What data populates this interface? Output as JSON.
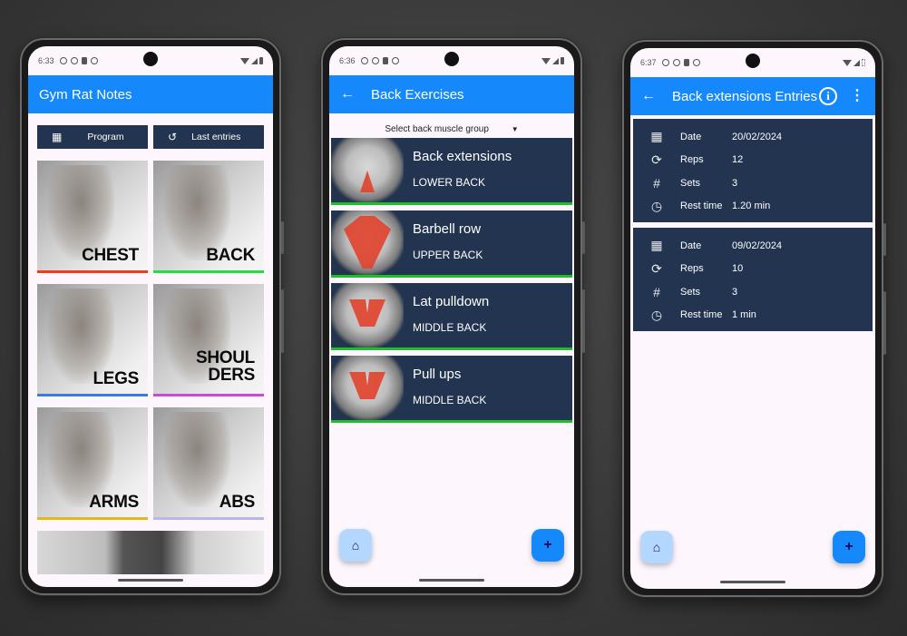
{
  "phones": [
    {
      "status": {
        "time": "6:33"
      },
      "appbar": {
        "title": "Gym Rat Notes"
      },
      "buttons": [
        {
          "label": "Program",
          "icon": "calendar-icon",
          "glyph": "▦"
        },
        {
          "label": "Last entries",
          "icon": "history-icon",
          "glyph": "↺"
        }
      ],
      "tiles": [
        {
          "label": "CHEST",
          "color": "#f33b16"
        },
        {
          "label": "BACK",
          "color": "#22e03a"
        },
        {
          "label": "LEGS",
          "color": "#3d7ae0"
        },
        {
          "label": "SHOUL\nDERS",
          "color": "#c84ad8"
        },
        {
          "label": "ARMS",
          "color": "#e8b61a"
        },
        {
          "label": "ABS",
          "color": "#b9b7ea"
        }
      ]
    },
    {
      "status": {
        "time": "6:36"
      },
      "appbar": {
        "back": "←",
        "title": "Back Exercises"
      },
      "dropdown": {
        "label": "Select back muscle group",
        "caret": "▼"
      },
      "exercises": [
        {
          "name": "Back extensions",
          "group": "LOWER BACK"
        },
        {
          "name": "Barbell row",
          "group": "UPPER BACK"
        },
        {
          "name": "Lat pulldown",
          "group": "MIDDLE BACK"
        },
        {
          "name": "Pull ups",
          "group": "MIDDLE BACK"
        }
      ],
      "fab_home": "⌂",
      "fab_add": "+"
    },
    {
      "status": {
        "time": "6:37"
      },
      "appbar": {
        "back": "←",
        "title": "Back extensions Entries",
        "info": "i",
        "more": "⋮"
      },
      "entries": [
        {
          "rows": [
            {
              "icon": "calendar-icon",
              "glyph": "▦",
              "label": "Date",
              "value": "20/02/2024"
            },
            {
              "icon": "repeat-icon",
              "glyph": "⟳",
              "label": "Reps",
              "value": "12"
            },
            {
              "icon": "hash-icon",
              "glyph": "#",
              "label": "Sets",
              "value": "3"
            },
            {
              "icon": "rest-timer-icon",
              "glyph": "◷",
              "label": "Rest time",
              "value": "1.20 min"
            }
          ]
        },
        {
          "rows": [
            {
              "icon": "calendar-icon",
              "glyph": "▦",
              "label": "Date",
              "value": "09/02/2024"
            },
            {
              "icon": "repeat-icon",
              "glyph": "⟳",
              "label": "Reps",
              "value": "10"
            },
            {
              "icon": "hash-icon",
              "glyph": "#",
              "label": "Sets",
              "value": "3"
            },
            {
              "icon": "rest-timer-icon",
              "glyph": "◷",
              "label": "Rest time",
              "value": "1 min"
            }
          ]
        }
      ],
      "fab_home": "⌂",
      "fab_add": "+"
    }
  ]
}
